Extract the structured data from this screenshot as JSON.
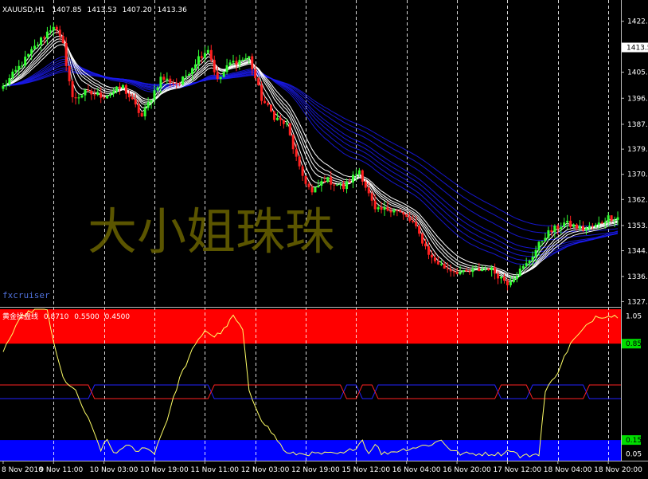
{
  "colors": {
    "background": "#000000",
    "bull_candle": "#33ff33",
    "bear_candle": "#ff2020",
    "ema_fast": "#ffffff",
    "ema_slow": "#1a1aee",
    "grid_line": "#ffffff",
    "upper_zone": "#ff0000",
    "lower_zone": "#0000ff",
    "oscillator": "#ffff66",
    "price_marker_bg": "#ffffff",
    "level_marker_bg": "#00dd00"
  },
  "chart_data": [
    {
      "type": "candlestick",
      "title": "XAUUSD,H1",
      "ohlc_header": [
        "1407.85",
        "1413.53",
        "1407.20",
        "1413.36"
      ],
      "watermark": "大小姐珠珠",
      "brand": "fxcruiser",
      "y_ticks": [
        "1422.2",
        "1405.0",
        "1396.2",
        "1387.4",
        "1379.0",
        "1370.5",
        "1362.0",
        "1353.2",
        "1344.7",
        "1336.0",
        "1327.5"
      ],
      "ylim": [
        1326,
        1424
      ],
      "current_price": 1413.36,
      "current_price_label": "1413.5",
      "x_ticks": [
        "8 Nov 2010",
        "9 Nov 11:00",
        "10 Nov 03:00",
        "10 Nov 19:00",
        "11 Nov 11:00",
        "12 Nov 03:00",
        "12 Nov 19:00",
        "15 Nov 12:00",
        "16 Nov 04:00",
        "16 Nov 20:00",
        "17 Nov 12:00",
        "18 Nov 04:00",
        "18 Nov 20:00"
      ],
      "x_anchor_index": [
        0,
        16,
        32,
        48,
        64,
        80,
        96,
        112,
        128,
        144,
        160,
        176,
        192
      ],
      "anchors": [
        [
          0,
          1400
        ],
        [
          6,
          1408
        ],
        [
          12,
          1416
        ],
        [
          16,
          1421
        ],
        [
          19,
          1414
        ],
        [
          22,
          1396
        ],
        [
          26,
          1398
        ],
        [
          32,
          1397
        ],
        [
          38,
          1400
        ],
        [
          44,
          1390
        ],
        [
          50,
          1403
        ],
        [
          56,
          1401
        ],
        [
          62,
          1410
        ],
        [
          65,
          1413
        ],
        [
          68,
          1402
        ],
        [
          72,
          1408
        ],
        [
          78,
          1410
        ],
        [
          82,
          1396
        ],
        [
          86,
          1390
        ],
        [
          90,
          1387
        ],
        [
          94,
          1372
        ],
        [
          98,
          1364
        ],
        [
          102,
          1369
        ],
        [
          108,
          1366
        ],
        [
          113,
          1372
        ],
        [
          118,
          1358
        ],
        [
          124,
          1359
        ],
        [
          130,
          1354
        ],
        [
          136,
          1342
        ],
        [
          140,
          1339
        ],
        [
          146,
          1337
        ],
        [
          154,
          1339
        ],
        [
          160,
          1334
        ],
        [
          166,
          1340
        ],
        [
          172,
          1350
        ],
        [
          178,
          1354
        ],
        [
          184,
          1352
        ],
        [
          188,
          1353
        ],
        [
          192,
          1356
        ]
      ]
    },
    {
      "type": "line",
      "title": "黄金操盘线",
      "params": [
        "0.8710",
        "0.5500",
        "0.4500"
      ],
      "y_ticks": [
        "1.05",
        "0.85",
        "0.15",
        "0.05"
      ],
      "ylim": [
        0,
        1.1
      ],
      "upper_zone": [
        0.85,
        1.1
      ],
      "lower_zone": [
        0,
        0.15
      ],
      "upper_band": 0.55,
      "lower_band": 0.45,
      "swaps": [
        [
          27,
          29
        ],
        [
          65,
          67
        ],
        [
          107,
          109
        ],
        [
          112,
          114
        ],
        [
          117,
          119
        ],
        [
          156,
          158
        ],
        [
          166,
          168
        ],
        [
          184,
          186
        ]
      ],
      "anchors": [
        [
          0,
          0.8
        ],
        [
          6,
          1.05
        ],
        [
          10,
          1.1
        ],
        [
          14,
          1.1
        ],
        [
          16,
          0.85
        ],
        [
          19,
          0.6
        ],
        [
          23,
          0.5
        ],
        [
          27,
          0.3
        ],
        [
          31,
          0.08
        ],
        [
          33,
          0.15
        ],
        [
          35,
          0.06
        ],
        [
          38,
          0.08
        ],
        [
          40,
          0.12
        ],
        [
          42,
          0.06
        ],
        [
          44,
          0.1
        ],
        [
          48,
          0.06
        ],
        [
          52,
          0.3
        ],
        [
          56,
          0.6
        ],
        [
          60,
          0.8
        ],
        [
          64,
          0.95
        ],
        [
          67,
          0.9
        ],
        [
          70,
          0.95
        ],
        [
          73,
          1.05
        ],
        [
          76,
          0.95
        ],
        [
          78,
          0.5
        ],
        [
          82,
          0.3
        ],
        [
          86,
          0.18
        ],
        [
          90,
          0.05
        ],
        [
          108,
          0.05
        ],
        [
          112,
          0.1
        ],
        [
          114,
          0.15
        ],
        [
          116,
          0.05
        ],
        [
          118,
          0.13
        ],
        [
          120,
          0.05
        ],
        [
          136,
          0.12
        ],
        [
          139,
          0.15
        ],
        [
          142,
          0.08
        ],
        [
          145,
          0.05
        ],
        [
          158,
          0.05
        ],
        [
          161,
          0.08
        ],
        [
          164,
          0.03
        ],
        [
          170,
          0.05
        ],
        [
          172,
          0.5
        ],
        [
          176,
          0.65
        ],
        [
          180,
          0.85
        ],
        [
          184,
          0.95
        ],
        [
          188,
          1.05
        ],
        [
          196,
          1.05
        ]
      ]
    }
  ]
}
